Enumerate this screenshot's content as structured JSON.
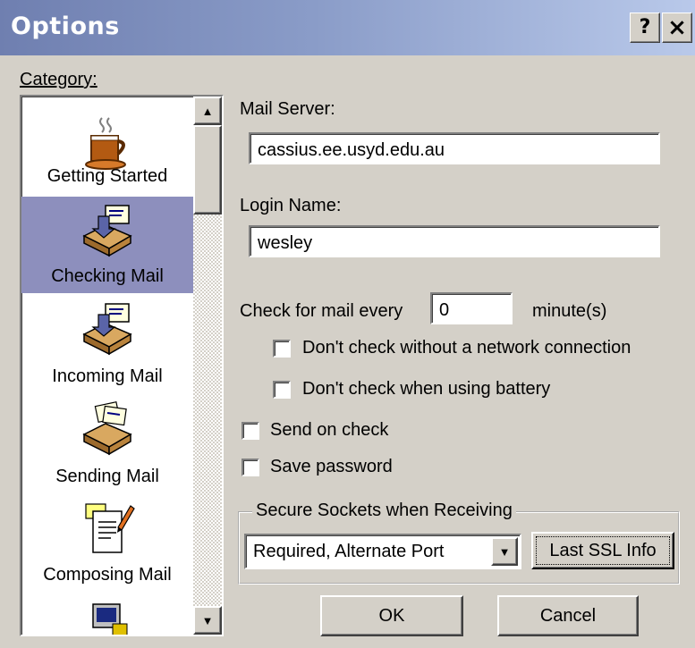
{
  "window": {
    "title": "Options",
    "help_button": "?",
    "close_button": "×"
  },
  "category": {
    "label": "Category:",
    "items": [
      {
        "label": "Getting Started",
        "icon": "coffee-cup-icon",
        "selected": false
      },
      {
        "label": "Checking Mail",
        "icon": "mailbox-tray-icon",
        "selected": true
      },
      {
        "label": "Incoming Mail",
        "icon": "mailbox-tray-icon",
        "selected": false
      },
      {
        "label": "Sending Mail",
        "icon": "outbox-tray-icon",
        "selected": false
      },
      {
        "label": "Composing Mail",
        "icon": "compose-document-icon",
        "selected": false
      }
    ]
  },
  "mail_server": {
    "label": "Mail Server:",
    "value": "cassius.ee.usyd.edu.au"
  },
  "login_name": {
    "label": "Login Name:",
    "value": "wesley"
  },
  "check_every": {
    "label": "Check for mail every",
    "value": "0",
    "unit": "minute(s)"
  },
  "options": {
    "no_network": {
      "label": "Don't check without a network connection",
      "checked": false
    },
    "no_battery": {
      "label": "Don't check when using battery",
      "checked": false
    },
    "send_on_check": {
      "label": "Send on check",
      "checked": false
    },
    "save_password": {
      "label": "Save password",
      "checked": false
    }
  },
  "ssl": {
    "group_label": "Secure Sockets when Receiving",
    "selected": "Required, Alternate Port",
    "info_button": "Last SSL Info"
  },
  "buttons": {
    "ok": "OK",
    "cancel": "Cancel"
  },
  "colors": {
    "title_start": "#6f7fb0",
    "title_end": "#b9c9ea",
    "selection": "#8d8fbd",
    "face": "#d4d0c8"
  }
}
